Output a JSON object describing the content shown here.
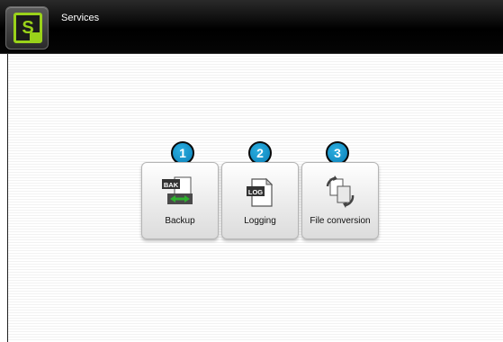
{
  "window": {
    "title": "Services",
    "app_icon_letter": "S"
  },
  "services": [
    {
      "number": "1",
      "label": "Backup",
      "icon": "backup-icon",
      "icon_text": "BAK"
    },
    {
      "number": "2",
      "label": "Logging",
      "icon": "logging-icon",
      "icon_text": "LOG"
    },
    {
      "number": "3",
      "label": "File conversion",
      "icon": "file-conversion-icon"
    }
  ],
  "colors": {
    "accent": "#9ad21a",
    "callout": "#1a9fd6",
    "titlebar": "#000000"
  }
}
